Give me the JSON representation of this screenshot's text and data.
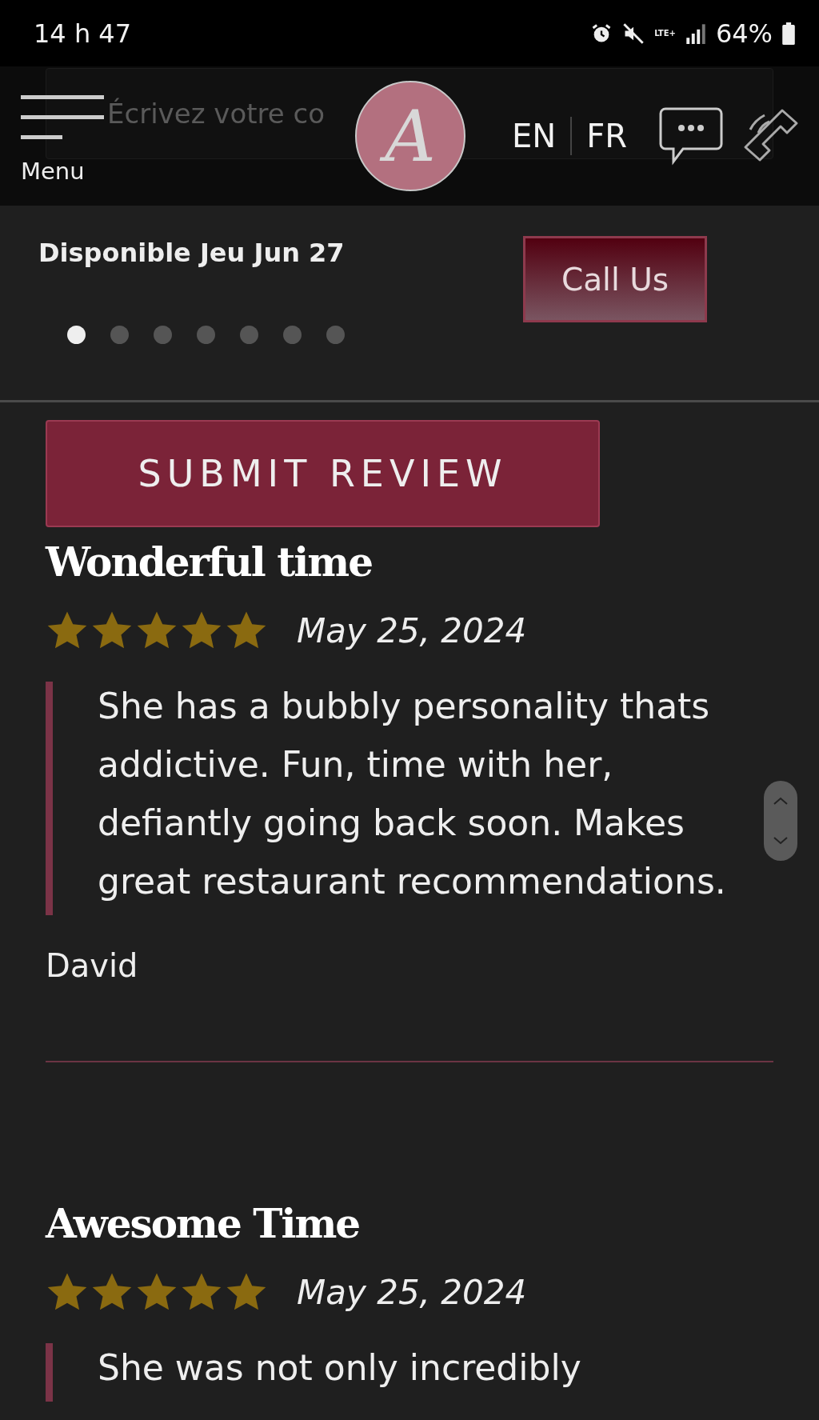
{
  "status_bar": {
    "time": "14 h 47",
    "battery": "64%",
    "network": "LTE+"
  },
  "header": {
    "search": {
      "placeholder": "Écrivez votre co"
    },
    "menu_label": "Menu",
    "logo_letter": "A",
    "languages": [
      {
        "label": "EN"
      },
      {
        "label": "FR"
      }
    ]
  },
  "banner": {
    "availability": "Disponible Jeu Jun 27",
    "call_button": "Call Us",
    "slides": [
      {
        "selected": true
      },
      {
        "selected": false
      },
      {
        "selected": false
      },
      {
        "selected": false
      },
      {
        "selected": false
      },
      {
        "selected": false
      },
      {
        "selected": false
      }
    ]
  },
  "submit_button": "SUBMIT REVIEW",
  "reviews": [
    {
      "title": "Wonderful time",
      "stars": 5,
      "date": "May 25, 2024",
      "text": "She has a bubbly personality thats addictive. Fun, time with her, defiantly going back soon. Makes great restaurant recommendations.",
      "author": "David"
    },
    {
      "title": "Awesome Time",
      "stars": 5,
      "date": "May 25, 2024",
      "text": "She was not only incredibly"
    }
  ]
}
